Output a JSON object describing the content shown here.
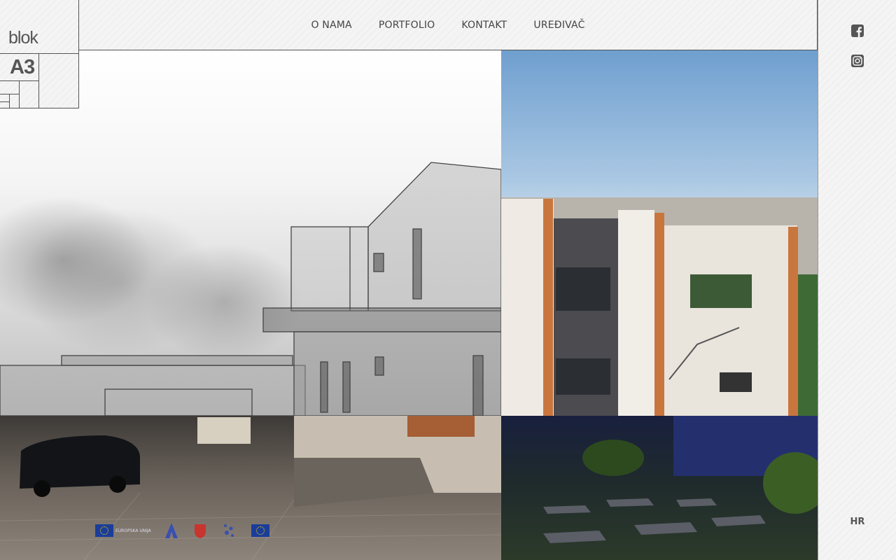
{
  "brand": {
    "wordmark": "blok",
    "submark": "A3"
  },
  "nav": {
    "items": [
      {
        "label": "O NAMA"
      },
      {
        "label": "PORTFOLIO"
      },
      {
        "label": "KONTAKT"
      },
      {
        "label": "UREĐIVAČ"
      }
    ]
  },
  "social": {
    "facebook_icon": "facebook-square-icon",
    "instagram_icon": "instagram-icon"
  },
  "language": {
    "label": "HR"
  },
  "sponsors": {
    "items": [
      {
        "text": "EUROPSKA UNIJA"
      },
      {
        "text": ""
      },
      {
        "text": ""
      },
      {
        "text": ""
      },
      {
        "text": ""
      }
    ]
  },
  "colors": {
    "ink": "#444444",
    "rail_border": "#999999",
    "eu_blue": "#1b3d9a"
  }
}
